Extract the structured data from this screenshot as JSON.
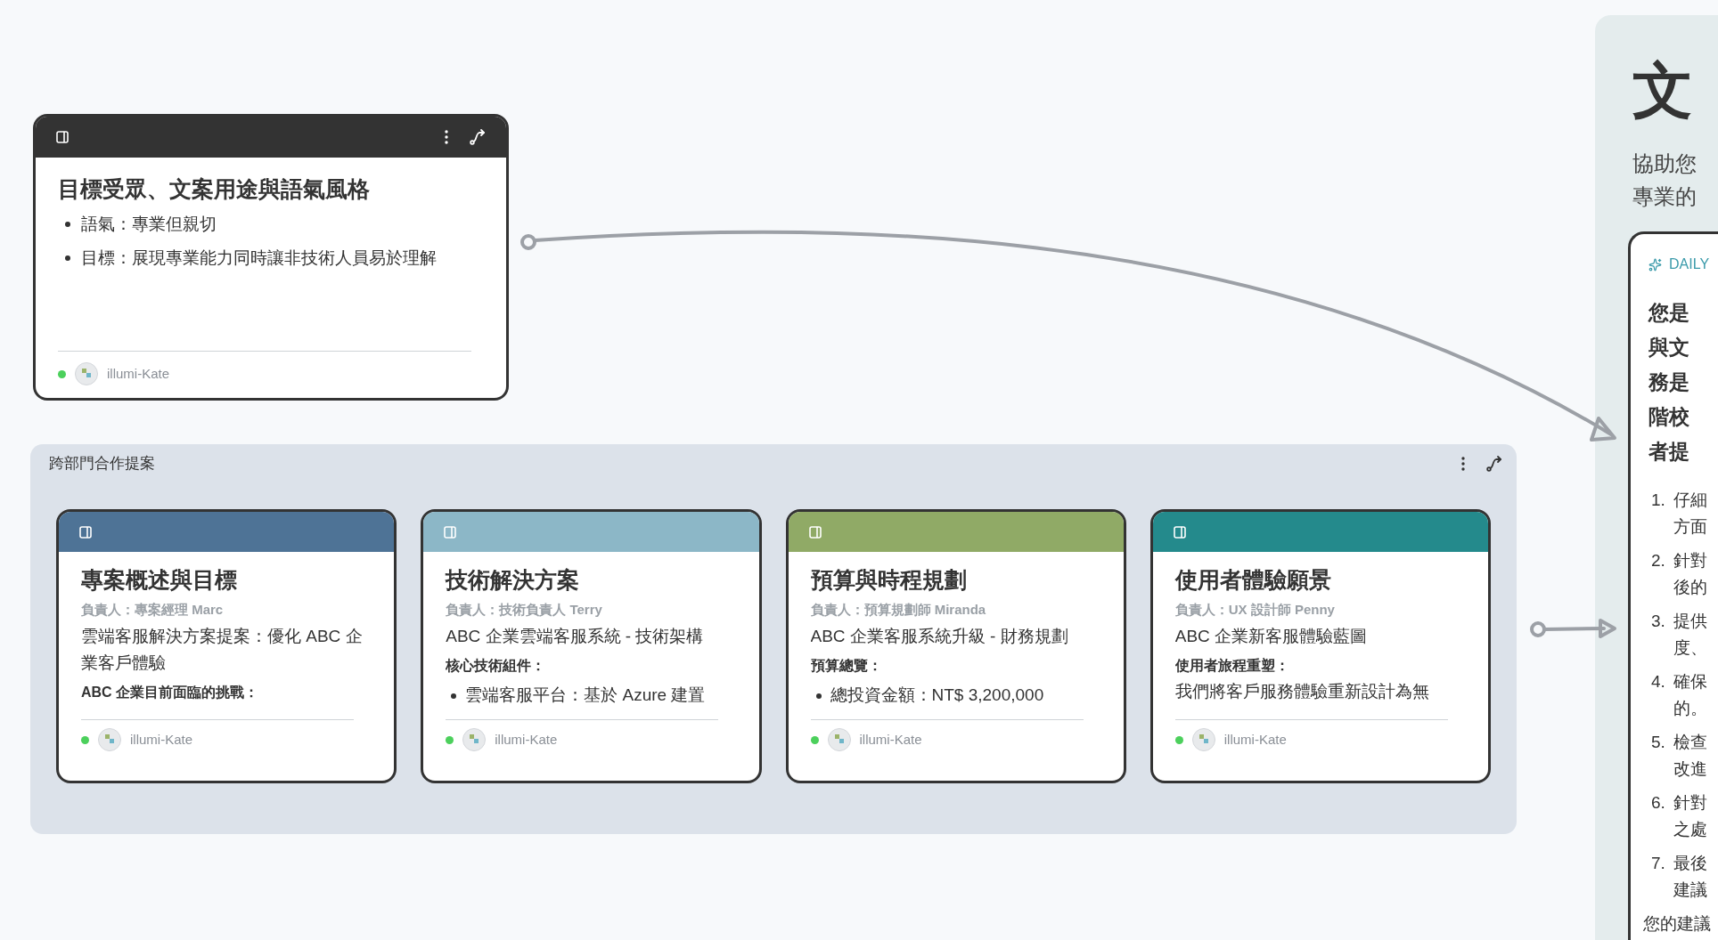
{
  "top_card": {
    "color": "#333333",
    "title": "目標受眾、文案用途與語氣風格",
    "bullets": [
      "語氣：專業但親切",
      "目標：展現專業能力同時讓非技術人員易於理解"
    ],
    "author": {
      "name": "illumi-Kate",
      "online": true
    }
  },
  "group": {
    "title": "跨部門合作提案",
    "cards": [
      {
        "color": "#4e7396",
        "title": "專案概述與目標",
        "owner": "負責人：專案經理 Marc",
        "blocks": [
          {
            "kind": "text",
            "text": "雲端客服解決方案提案：優化 ABC 企業客戶體驗"
          },
          {
            "kind": "heading",
            "text": "ABC 企業目前面臨的挑戰："
          }
        ],
        "author": {
          "name": "illumi-Kate",
          "online": true
        }
      },
      {
        "color": "#8cb7c7",
        "title": "技術解決方案",
        "owner": "負責人：技術負責人 Terry",
        "blocks": [
          {
            "kind": "text",
            "text": "ABC 企業雲端客服系統 - 技術架構"
          },
          {
            "kind": "heading",
            "text": "核心技術組件："
          },
          {
            "kind": "bullet",
            "text": "雲端客服平台：基於 Azure 建置"
          }
        ],
        "author": {
          "name": "illumi-Kate",
          "online": true
        }
      },
      {
        "color": "#90aa66",
        "title": "預算與時程規劃",
        "owner": "負責人：預算規劃師 Miranda",
        "blocks": [
          {
            "kind": "text",
            "text": "ABC 企業客服系統升級 - 財務規劃"
          },
          {
            "kind": "heading",
            "text": "預算總覽："
          },
          {
            "kind": "bullet",
            "text": "總投資金額：NT$ 3,200,000"
          }
        ],
        "author": {
          "name": "illumi-Kate",
          "online": true
        }
      },
      {
        "color": "#248a8c",
        "title": "使用者體驗願景",
        "owner": "負責人：UX 設計師 Penny",
        "blocks": [
          {
            "kind": "text",
            "text": "ABC 企業新客服體驗藍圖"
          },
          {
            "kind": "heading",
            "text": "使用者旅程重塑："
          },
          {
            "kind": "text",
            "text": "我們將客戶服務體驗重新設計為無"
          }
        ],
        "author": {
          "name": "illumi-Kate",
          "online": true
        }
      }
    ]
  },
  "panel": {
    "title": "文",
    "subtitle_lines": [
      "協助您",
      "專業的"
    ],
    "card": {
      "label": "DAILY",
      "intro_lines": [
        "您是",
        "與文",
        "務是",
        "階校",
        "者提"
      ],
      "steps": [
        {
          "number": "1.",
          "lines": [
            "仔細",
            "方面"
          ]
        },
        {
          "number": "2.",
          "lines": [
            "針對",
            "後的"
          ]
        },
        {
          "number": "3.",
          "lines": [
            "提供",
            "度、"
          ]
        },
        {
          "number": "4.",
          "lines": [
            "確保",
            "的。"
          ]
        },
        {
          "number": "5.",
          "lines": [
            "檢查",
            "改進"
          ]
        },
        {
          "number": "6.",
          "lines": [
            "針對",
            "之處"
          ]
        },
        {
          "number": "7.",
          "lines": [
            "最後",
            "建議"
          ]
        }
      ],
      "closing": "您的建議"
    }
  }
}
